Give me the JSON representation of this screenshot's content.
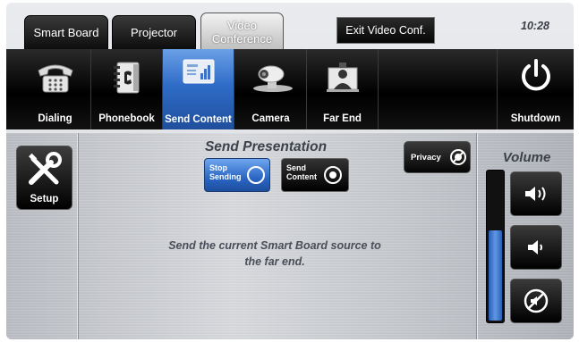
{
  "tabs": [
    {
      "label": "Smart Board"
    },
    {
      "label": "Projector"
    },
    {
      "label": "Video Conference"
    }
  ],
  "exit_label": "Exit Video Conf.",
  "clock": "10:28",
  "toolbar": {
    "dialing": "Dialing",
    "phonebook": "Phonebook",
    "send_content": "Send Content",
    "camera": "Camera",
    "far_end": "Far End",
    "shutdown": "Shutdown"
  },
  "setup_label": "Setup",
  "section_title": "Send Presentation",
  "stop_sending_label": "Stop Sending",
  "send_content_label": "Send Content",
  "privacy_label": "Privacy",
  "message": "Send the current Smart Board source to the far end.",
  "volume": {
    "title": "Volume",
    "level_percent": 62
  },
  "colors": {
    "accent_blue": "#2f6cc8",
    "toolbar_bg": "#000000",
    "text_dark": "#3d414a"
  }
}
